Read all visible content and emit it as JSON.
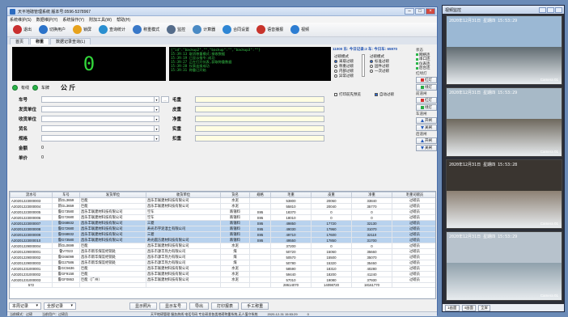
{
  "window": {
    "title": "天平地磅管理系统 版本号:0596-5378967",
    "menus": [
      "系统维护(S)",
      "数据维护(Y)",
      "系统操作(Y)",
      "附加工具(W)",
      "帮助(H)"
    ]
  },
  "toolbar": [
    {
      "label": "退出",
      "color": "#c93030"
    },
    {
      "label": "切换用户",
      "color": "#2c73c9"
    },
    {
      "label": "锁屏",
      "color": "#e7a21c"
    },
    {
      "label": "查询统计",
      "color": "#2a8fd0"
    },
    {
      "label": "称重模式",
      "color": "#3978c8"
    },
    {
      "label": "监控",
      "color": "#556c8a"
    },
    {
      "label": "计算器",
      "color": "#4a8ac4"
    },
    {
      "label": "合同设置",
      "color": "#2f86d4"
    },
    {
      "label": "语音播报",
      "color": "#c8342c"
    },
    {
      "label": "视频",
      "color": "#2d7dd2"
    }
  ],
  "tabs": [
    {
      "label": "首页"
    },
    {
      "label": "称重"
    },
    {
      "label": "数据记录查询(L)"
    }
  ],
  "weight_display": "0",
  "log_lines": [
    "{\"id\":\"backup2\",\"\",\"backup\":\"\",\"backup3\":\"\"}",
    "15:39:13 取消称重模式:接收数据",
    "15:39:19 已显示指令:成功",
    "15:39:27 正在打开仪表,获取称重数据",
    "15:39:28 仪表连接成功",
    "15:39:31 称重已开始"
  ],
  "indicators": {
    "comm": "有线",
    "plate": "车牌",
    "unit": "公 斤"
  },
  "options": {
    "header": "11000 东: 今日记录:2 车: 今日车: 65970",
    "match_label": "过磅模式",
    "filter_label": "过磅模式",
    "match": [
      {
        "label": "采取过磅",
        "on": true
      },
      {
        "label": "称重过磅",
        "on": false
      },
      {
        "label": "内部过磅",
        "on": false
      },
      {
        "label": "异常过磅",
        "on": false
      }
    ],
    "filter": [
      {
        "label": "标准过磅",
        "on": true
      },
      {
        "label": "固件过磅",
        "on": false
      },
      {
        "label": "一次过磅",
        "on": false
      }
    ],
    "print_preview": "打印前先预览",
    "auto_weigh": "自动过磅"
  },
  "status": {
    "title": "状态",
    "lamps": [
      "网络连",
      "串口连",
      "仪表连",
      "后台连"
    ],
    "barrier1_title": "前道闸",
    "barrier2_title": "后道闸",
    "light_title": "红绿灯",
    "gate_title": "车道闸",
    "red": "红灯",
    "green": "绿灯",
    "open": "开闸",
    "close": "关闸"
  },
  "form": {
    "vehicle": "车号",
    "sender": "发货单位",
    "receiver": "收货单位",
    "goods": "货名",
    "spec": "规格",
    "amount": "金额",
    "price": "单价",
    "gross": "毛重",
    "tare": "皮重",
    "net": "净重",
    "actual": "实重",
    "deduct": "扣重",
    "amount_value": "0",
    "price_value": "0",
    "ellipsis": "..."
  },
  "table": {
    "headers": [
      "流水号",
      "车号",
      "发货单位",
      "收货单位",
      "货名",
      "规格",
      "毛重",
      "皮重",
      "净重",
      "毛重司磅员"
    ],
    "rows": [
      [
        "A20201223000003",
        "新GL3659",
        "巨能",
        "昌乐丰联建材科技有限公司",
        "水泥",
        "",
        "53800",
        "20060",
        "33840",
        "过磅员"
      ],
      [
        "A20201223000004",
        "新GL3659",
        "巨能",
        "昌乐丰联建材科技有限公司",
        "水泥",
        "",
        "55810",
        "20040",
        "35770",
        "过磅员"
      ],
      [
        "A20201223000005",
        "鲁G73580",
        "昌乐丰联建材科技有限公司",
        "空车",
        "跌锤料",
        "S95",
        "18370",
        "0",
        "0",
        "过磅员"
      ],
      [
        "A20201223000006",
        "鲁G72680",
        "昌乐丰联建材科技有限公司",
        "空车",
        "跌锤料",
        "S95",
        "18010",
        "0",
        "0",
        "过磅员"
      ],
      [
        "A20201223000007",
        "鲁G68832",
        "昌乐丰联建材科技有限公司",
        "三菱",
        "跌锤料",
        "S95",
        "49850",
        "17720",
        "32130",
        "过磅员"
      ],
      [
        "A20201223000008",
        "鲁G72680",
        "昌乐丰联建材科技有限公司",
        "寿光市宇泥混土有限公司",
        "跌锤料",
        "S95",
        "49030",
        "17960",
        "31070",
        "过磅员"
      ],
      [
        "A20201223000009",
        "鲁G68832",
        "昌乐丰联建材科技有限公司",
        "三菱",
        "跌锤料",
        "S95",
        "49710",
        "17600",
        "32110",
        "过磅员"
      ],
      [
        "A20201223000010",
        "鲁G73580",
        "昌乐丰联建材科技有限公司",
        "寿光圆方建材科技有限公司",
        "跌锤料",
        "S95",
        "49550",
        "17850",
        "31700",
        "过磅员"
      ],
      [
        "A20201229000004",
        "新GL0699",
        "巨能",
        "昌乐丰联建材科技有限公司",
        "水泥",
        "",
        "37200",
        "0",
        "0",
        "过磅员"
      ],
      [
        "A20201229000001",
        "鲁V7023",
        "昌乐市新华煤炭经销处",
        "昌乐市源丰热力有限公司",
        "煤",
        "",
        "50720",
        "15060",
        "35660",
        "过磅员"
      ],
      [
        "A20201229000002",
        "鲁G66099",
        "昌乐市新华煤炭经销处",
        "昌乐市源丰热力有限公司",
        "煤",
        "",
        "50570",
        "15500",
        "35070",
        "过磅员"
      ],
      [
        "A20201229000003",
        "鲁G27586",
        "昌乐市新华煤炭经销处",
        "昌乐市源丰热力有限公司",
        "煤",
        "",
        "50780",
        "15320",
        "35460",
        "过磅员"
      ],
      [
        "A20201231000001",
        "鲁GC5636",
        "巨能",
        "昌乐丰联建材科技有限公司",
        "水泥",
        "",
        "58590",
        "18310",
        "40280",
        "过磅员"
      ],
      [
        "A20201231000002",
        "鲁GF9158",
        "巨能",
        "昌乐丰联建材科技有限公司",
        "水泥",
        "",
        "59440",
        "18200",
        "41240",
        "过磅员"
      ],
      [
        "A20201231000003",
        "鲁GF0863",
        "巨能（广州）",
        "昌乐丰联建材科技有限公司",
        "水泥",
        "",
        "57010",
        "19080",
        "37930",
        "过磅员"
      ]
    ],
    "selected_rows": [
      4,
      5,
      6,
      7
    ],
    "totals": [
      "572",
      "",
      "",
      "",
      "",
      "",
      "28614070",
      "14098720",
      "18161770",
      ""
    ]
  },
  "bottom": {
    "filter1": "本周记录",
    "filter2": "全部记录",
    "buttons": [
      "显示照片",
      "显示车号",
      "导出",
      "打印报表",
      "手工称重"
    ]
  },
  "statusbar": {
    "left1": "当前模式：过磅",
    "left2": "当前用户：过磅员",
    "center": "天平地磅管理 服务热线 电话号码 专业研发各类地磅称重系统,无人值守系统",
    "time": "2020-12-31 15:53:29",
    "right": "0"
  },
  "camera": {
    "title": "视频监控",
    "feeds": [
      {
        "ts": "2020年12月31日 星期四 15:53:29",
        "name": "Camera 01",
        "sky": "#9bb8d4",
        "ground": "#5f6a70"
      },
      {
        "ts": "2020年12月31日 星期四 15:53:29",
        "name": "Camera 01",
        "sky": "#a7b9c7",
        "ground": "#6d675c"
      },
      {
        "ts": "2020年12月31日 星期四 15:53:28",
        "name": "Camera 01",
        "sky": "#3a3530",
        "ground": "#8c8073"
      },
      {
        "ts": "2020年12月31日 星期四 15:53:29",
        "name": "Camera 01",
        "sky": "#b7c2cc",
        "ground": "#8fa0ab"
      }
    ],
    "footer": [
      "1画面",
      "4画面",
      "全屏"
    ]
  }
}
